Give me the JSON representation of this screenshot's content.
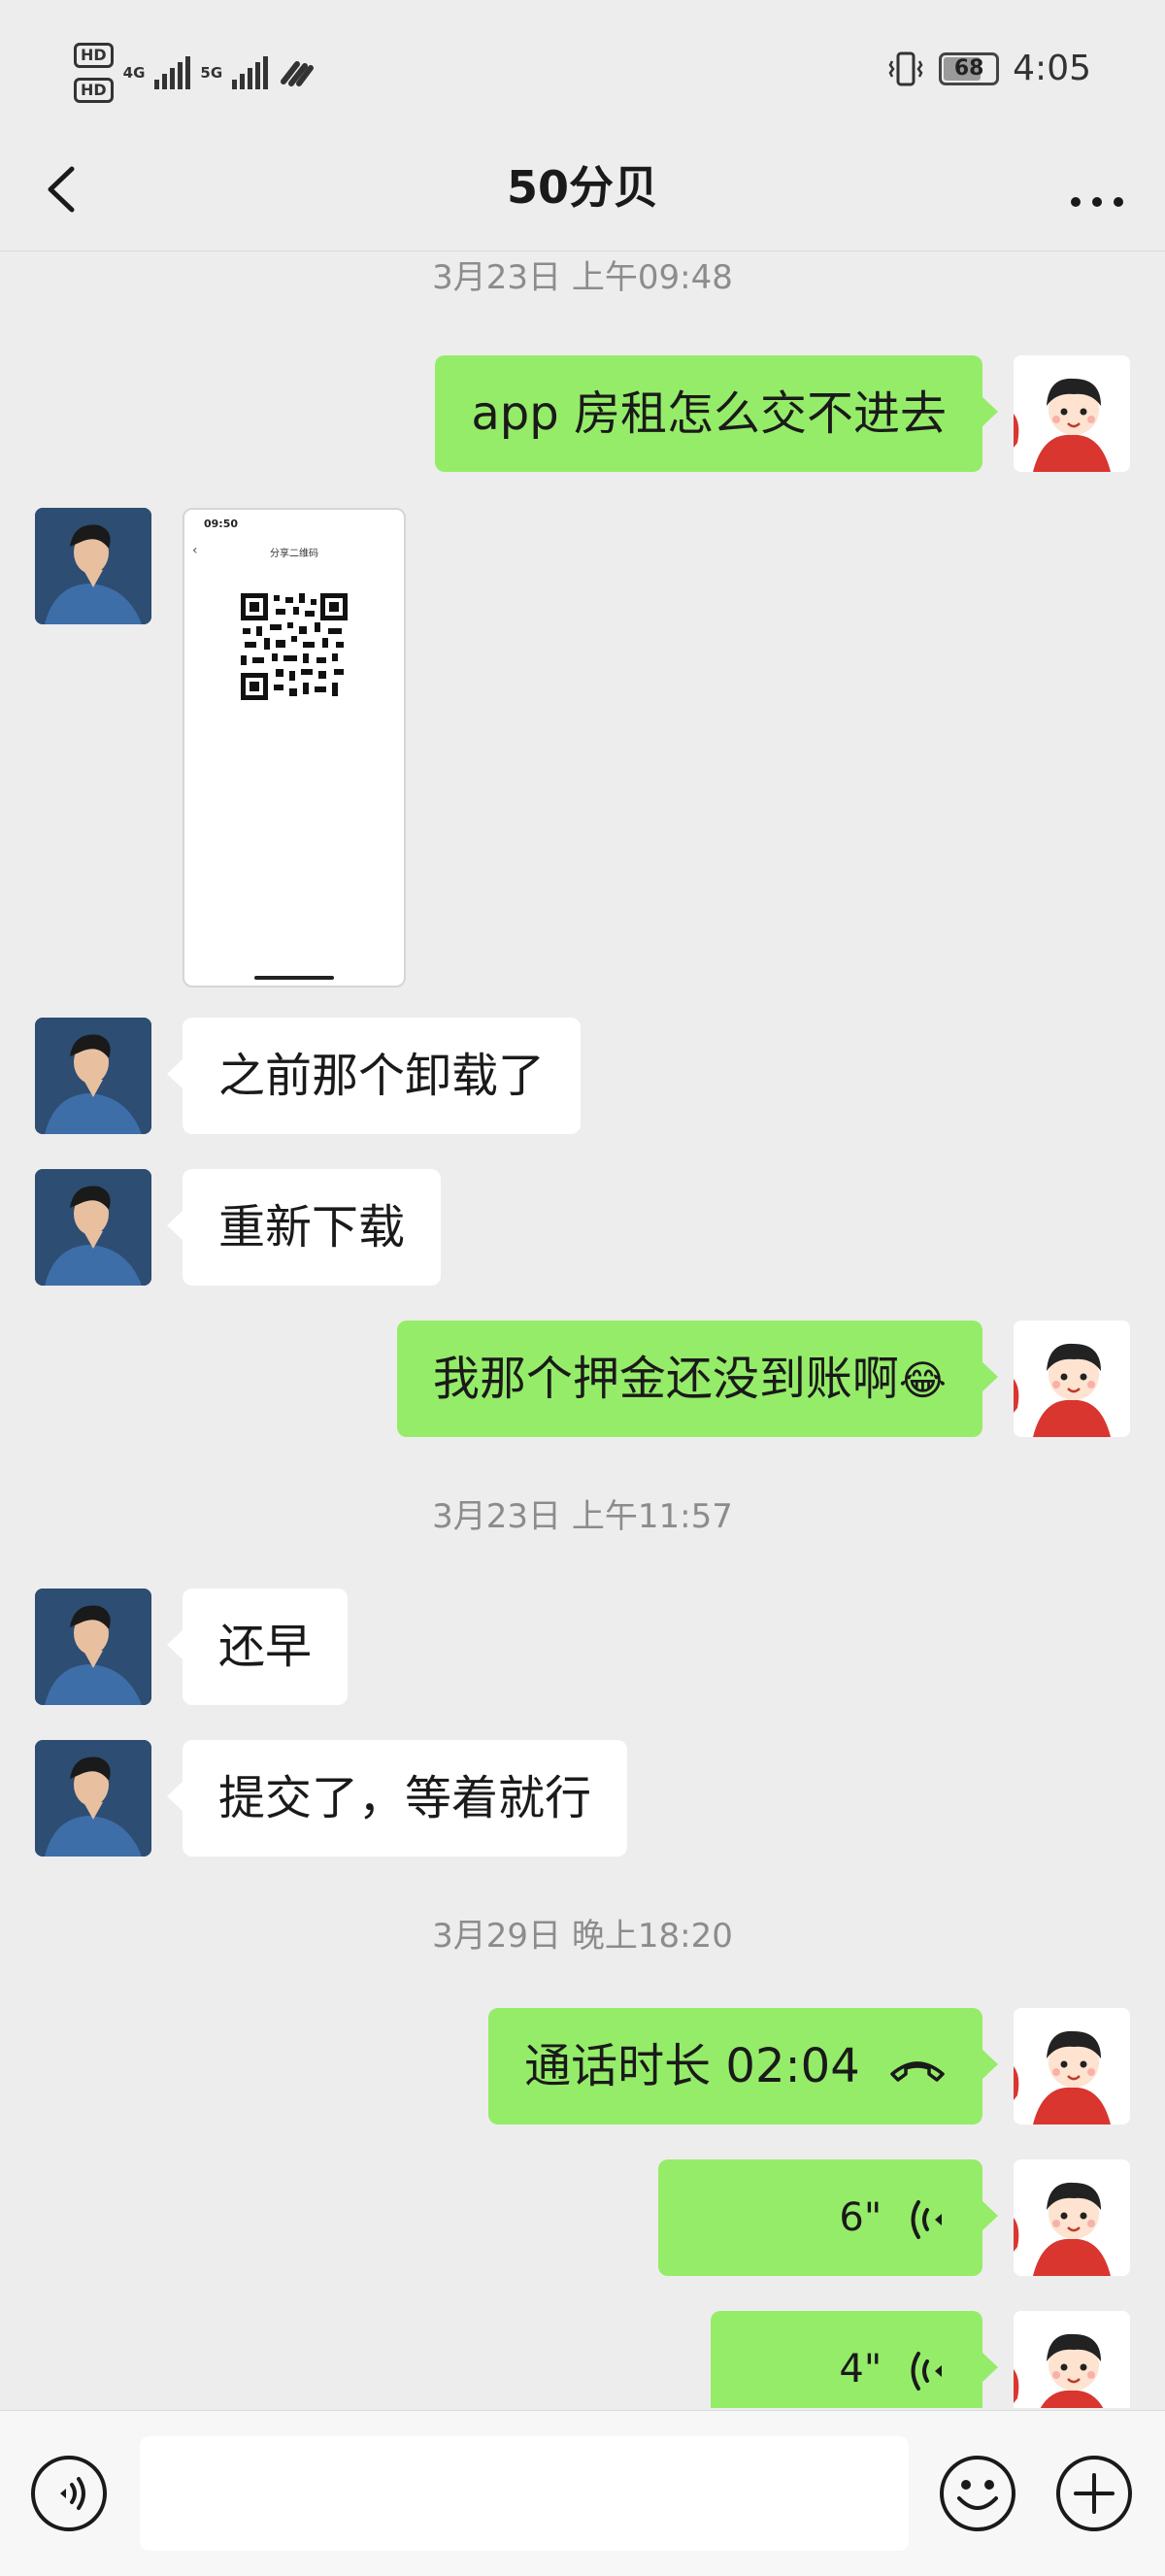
{
  "status_bar": {
    "time": "4:05",
    "battery": "68",
    "sim1": "HD",
    "sim2": "HD",
    "net1": "4G",
    "net2": "5G"
  },
  "header": {
    "title": "50分贝"
  },
  "messages": {
    "ts1": "3月23日 上午09:48",
    "m1": "app 房租怎么交不进去",
    "img": {
      "time": "09:50",
      "title": "分享二维码"
    },
    "m3": "之前那个卸载了",
    "m4": "重新下载",
    "m5": "我那个押金还没到账啊",
    "m5_emoji": "😂",
    "ts2": "3月23日 上午11:57",
    "m6": "还早",
    "m7": "提交了，等着就行",
    "ts3": "3月29日 晚上18:20",
    "m8": "通话时长 02:04",
    "m9": "6\"",
    "m10": "4\""
  },
  "colors": {
    "background": "#ededed",
    "sent_bubble": "#95ec69",
    "received_bubble": "#ffffff",
    "timestamp": "#8c8c8c"
  },
  "icons": {
    "back": "chevron-left-icon",
    "more": "more-dots-icon",
    "voice_input": "voice-input-icon",
    "emoji": "emoji-icon",
    "plus": "plus-icon",
    "call": "phone-hangup-icon",
    "voice_msg": "voice-wave-icon"
  }
}
